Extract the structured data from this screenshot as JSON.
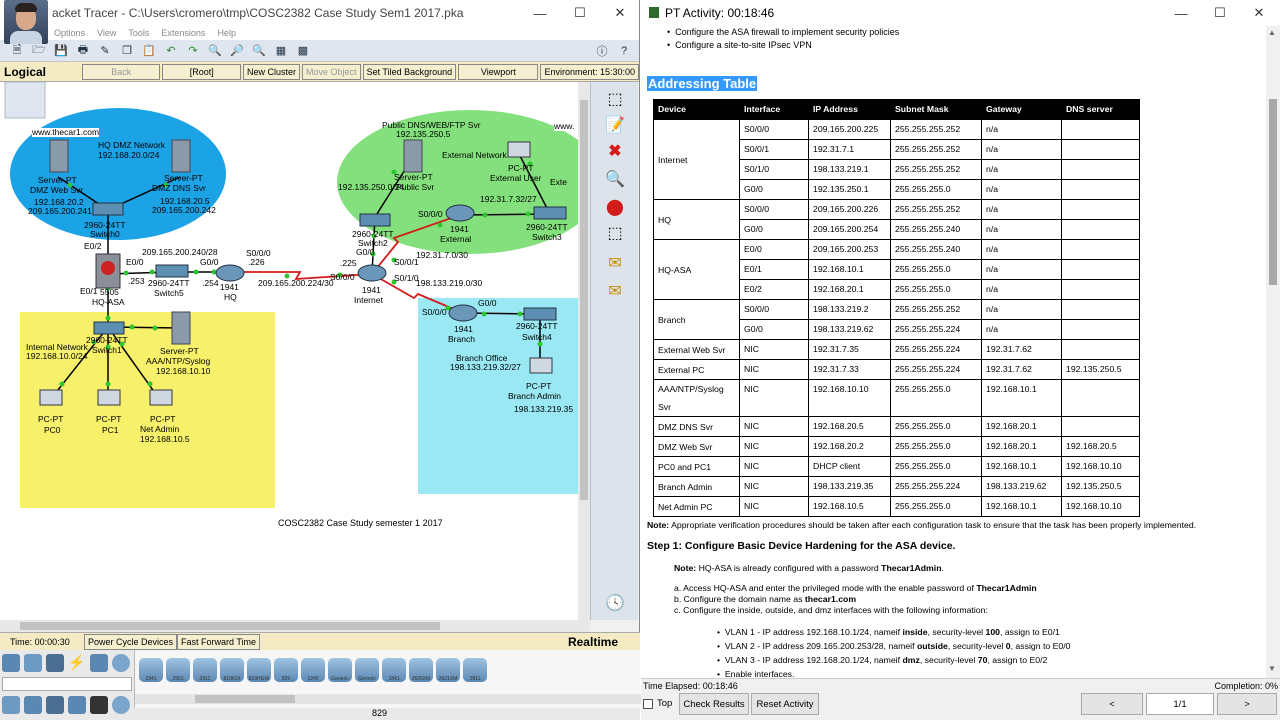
{
  "pt": {
    "title": "Cisco Packet Tracer - C:\\Users\\cromero\\tmp\\COSC2382 Case Study Sem1 2017.pka",
    "title_visible": "acket Tracer - C:\\Users\\cromero\\tmp\\COSC2382 Case Study Sem1 2017.pka",
    "menu": [
      "Options",
      "View",
      "Tools",
      "Extensions",
      "Help"
    ],
    "nav": {
      "mode": "Logical",
      "back": "Back",
      "root": "[Root]",
      "new_cluster": "New Cluster",
      "move_object": "Move Object",
      "tiled_bg": "Set Tiled Background",
      "viewport": "Viewport",
      "env": "Environment: 15:30:00"
    },
    "canvas_caption": "COSC2382 Case Study semester 1 2017",
    "labels": {
      "thecar1": "www.thecar1.com",
      "hq_dmz": "HQ DMZ Network",
      "hq_dmz_net": "192.168.20.0/24",
      "web_svr": "Server-PT",
      "web_svr2": "DMZ Web Svr",
      "web_ip1": "192.168.20.2",
      "web_ip2": "209.165.200.241",
      "dns_svr": "Server-PT",
      "dns_svr2": "DMZ DNS Svr",
      "dns_ip1": "192.168.20.5",
      "dns_ip2": "209.165.200.242",
      "sw0": "2960-24TT",
      "sw0b": "Switch0",
      "e02": "E0/2",
      "e00": "E0/0",
      "e01": "E0/1",
      "asa": "5505",
      "asa2": "HQ-ASA",
      "net240": "209.165.200.240/28",
      "dot253": ".253",
      "dot254": ".254",
      "sw5": "2960-24TT",
      "sw5b": "Switch5",
      "g00a": "G0/0",
      "hq": "1941",
      "hq2": "HQ",
      "s000": "S0/0/0",
      "dot226": ".226",
      "net224": "209.165.200.224/30",
      "dot225": ".225",
      "s000b": "S0/0/0",
      "inet": "1941",
      "inet2": "Internet",
      "s001": "S0/0/1",
      "s010": "S0/1/0",
      "net230": "192.31.7.0/30",
      "net219": "198.133.219.0/30",
      "pub_dns": "Public DNS/WEB/FTP Svr",
      "pub_ip": "192.135.250.5",
      "pub_svr": "Server-PT",
      "pub_svr2": "Public Svr",
      "net250": "192.135.250.0/24",
      "sw2": "2960-24TT",
      "sw2b": "Switch2",
      "g00b": "G0/0",
      "ext_net": "External Network",
      "ext_pc": "PC-PT",
      "ext_pc2": "External User",
      "s000c": "S0/0/0",
      "net732": "192.31.7.32/27",
      "ext": "1941",
      "ext2": "External",
      "sw3": "2960-24TT",
      "sw3b": "Switch3",
      "www": "www.",
      "ext_cut": "Exte",
      "s000d": "S0/0/0",
      "g00c": "G0/0",
      "br": "1941",
      "br2": "Branch",
      "sw4": "2960-24TT",
      "sw4b": "Switch4",
      "br_off": "Branch Office",
      "br_net": "198.133.219.32/27",
      "br_pc": "PC-PT",
      "br_pc2": "Branch Admin",
      "br_ip": "198.133.219.35",
      "int_net": "Internal Network",
      "int_net2": "192.168.10.0/24",
      "sw1": "2960-24TT",
      "sw1b": "Switch1",
      "aaa": "Server-PT",
      "aaa2": "AAA/NTP/Syslog",
      "aaa_ip": "192.168.10.10",
      "pc0": "PC-PT",
      "pc0b": "PC0",
      "pc1": "PC-PT",
      "pc1b": "PC1",
      "na": "PC-PT",
      "na2": "Net Admin",
      "na_ip": "192.168.10.5"
    },
    "status": {
      "time": "Time: 00:00:30",
      "power": "Power Cycle Devices",
      "fft": "Fast Forward Time",
      "realtime": "Realtime"
    },
    "devices": [
      "1941",
      "2901",
      "2911",
      "819IOX",
      "819HGW",
      "829",
      "1240",
      "Generic",
      "Generic",
      "1841",
      "2620XM",
      "2621XM",
      "2811"
    ],
    "bottom_label": "829"
  },
  "activity": {
    "title": "PT Activity: 00:18:46",
    "bullets": [
      "Configure the ASA firewall to implement security policies",
      "Configure a site-to-site IPsec VPN"
    ],
    "heading": "Addressing Table",
    "columns": [
      "Device",
      "Interface",
      "IP Address",
      "Subnet Mask",
      "Gateway",
      "DNS server"
    ],
    "groups": [
      {
        "device": "Internet",
        "rows": [
          [
            "S0/0/0",
            "209.165.200.225",
            "255.255.255.252",
            "n/a",
            ""
          ],
          [
            "S0/0/1",
            "192.31.7.1",
            "255.255.255.252",
            "n/a",
            ""
          ],
          [
            "S0/1/0",
            "198.133.219.1",
            "255.255.255.252",
            "n/a",
            ""
          ],
          [
            "G0/0",
            "192.135.250.1",
            "255.255.255.0",
            "n/a",
            ""
          ]
        ]
      },
      {
        "device": "HQ",
        "rows": [
          [
            "S0/0/0",
            "209.165.200.226",
            "255.255.255.252",
            "n/a",
            ""
          ],
          [
            "G0/0",
            "209.165.200.254",
            "255.255.255.240",
            "n/a",
            ""
          ]
        ]
      },
      {
        "device": "HQ-ASA",
        "rows": [
          [
            "E0/0",
            "209.165.200.253",
            "255.255.255.240",
            "n/a",
            ""
          ],
          [
            "E0/1",
            "192.168.10.1",
            "255.255.255.0",
            "n/a",
            ""
          ],
          [
            "E0/2",
            "192.168.20.1",
            "255.255.255.0",
            "n/a",
            ""
          ]
        ]
      },
      {
        "device": "Branch",
        "rows": [
          [
            "S0/0/0",
            "198.133.219.2",
            "255.255.255.252",
            "n/a",
            ""
          ],
          [
            "G0/0",
            "198.133.219.62",
            "255.255.255.224",
            "n/a",
            ""
          ]
        ]
      },
      {
        "device": "External Web Svr",
        "rows": [
          [
            "NIC",
            "192.31.7.35",
            "255.255.255.224",
            "192.31.7.62",
            ""
          ]
        ]
      },
      {
        "device": "External PC",
        "rows": [
          [
            "NIC",
            "192.31.7.33",
            "255.255.255.224",
            "192.31.7.62",
            "192.135.250.5"
          ]
        ]
      },
      {
        "device": "AAA/NTP/Syslog Svr",
        "rows": [
          [
            "NIC",
            "192.168.10.10",
            "255.255.255.0",
            "192.168.10.1",
            ""
          ]
        ]
      },
      {
        "device": "DMZ DNS Svr",
        "rows": [
          [
            "NIC",
            "192.168.20.5",
            "255.255.255.0",
            "192.168.20.1",
            ""
          ]
        ]
      },
      {
        "device": "DMZ Web Svr",
        "rows": [
          [
            "NIC",
            "192.168.20.2",
            "255.255.255.0",
            "192.168.20.1",
            "192.168.20.5"
          ]
        ]
      },
      {
        "device": "PC0 and PC1",
        "rows": [
          [
            "NIC",
            "DHCP client",
            "255.255.255.0",
            "192.168.10.1",
            "192.168.10.10"
          ]
        ]
      },
      {
        "device": "Branch Admin",
        "rows": [
          [
            "NIC",
            "198.133.219.35",
            "255.255.255.224",
            "198.133.219.62",
            "192.135.250.5"
          ]
        ]
      },
      {
        "device": "Net Admin PC",
        "rows": [
          [
            "NIC",
            "192.168.10.5",
            "255.255.255.0",
            "192.168.10.1",
            "192.168.10.10"
          ]
        ]
      }
    ],
    "note_label": "Note:",
    "note": "Appropriate verification procedures should be taken after each configuration task to ensure that the task has been properly implemented.",
    "step1": "Step 1: Configure Basic Device Hardening for the ASA device.",
    "step_note_label": "Note:",
    "step_note": "HQ-ASA is already configured with a password ",
    "step_note_pw": "Thecar1Admin",
    "step_note_end": ".",
    "a_text": "a. Access HQ-ASA and enter the privileged mode with the enable password of ",
    "a_pw": "Thecar1Admin",
    "b_text": "b. Configure the domain name as ",
    "b_val": "thecar1.com",
    "c_text": "c. Configure the inside, outside, and dmz interfaces with the following information:",
    "vlan1": [
      "VLAN 1 - IP address 192.168.10.1/24, nameif ",
      "inside",
      ", security-level ",
      "100",
      ", assign to E0/1"
    ],
    "vlan2": [
      "VLAN 2 - IP address 209.165.200.253/28, nameif ",
      "outside",
      ", security-level ",
      "0",
      ", assign to E0/0"
    ],
    "vlan3": [
      "VLAN 3 - IP address 192.168.20.1/24, nameif ",
      "dmz",
      ", security-level ",
      "70",
      ", assign to E0/2"
    ],
    "enable": "Enable interfaces.",
    "elapsed": "Time Elapsed: 00:18:46",
    "completion": "Completion: 0%",
    "top": "Top",
    "check": "Check Results",
    "reset": "Reset Activity",
    "prev": "<",
    "page": "1/1",
    "next": ">"
  }
}
